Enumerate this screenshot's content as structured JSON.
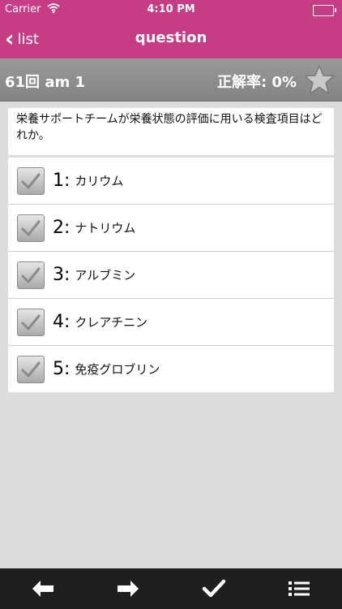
{
  "status": {
    "carrier": "Carrier",
    "time": "4:10 PM"
  },
  "nav": {
    "back_label": "list",
    "title": "question"
  },
  "info": {
    "exam": "61回  am 1",
    "rate": "正解率: 0%"
  },
  "question": {
    "text": "栄養サポートチームが栄養状態の評価に用いる検査項目はどれか。"
  },
  "choices": [
    {
      "num": "1:",
      "text": "カリウム"
    },
    {
      "num": "2:",
      "text": "ナトリウム"
    },
    {
      "num": "3:",
      "text": "アルブミン"
    },
    {
      "num": "4:",
      "text": "クレアチニン"
    },
    {
      "num": "5:",
      "text": "免疫グロブリン"
    }
  ],
  "toolbar": {
    "icons": [
      "arrow-left-icon",
      "arrow-right-icon",
      "check-icon",
      "list-icon"
    ]
  },
  "colors": {
    "brand": "#c63d86",
    "info_bar": "#8f8f8f",
    "toolbar": "#1f1f1f"
  }
}
